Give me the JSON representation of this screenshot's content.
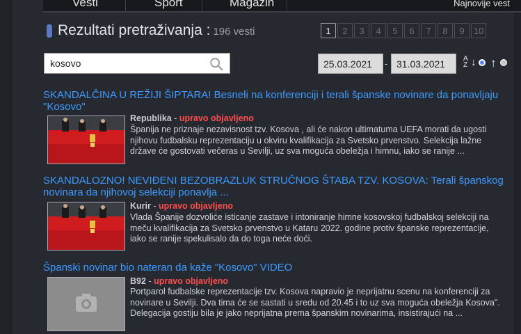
{
  "nav": {
    "items": [
      "Vesti",
      "Sport",
      "Magazin"
    ],
    "right": "Najnovije vest"
  },
  "search_header": {
    "title": "Rezultati pretraživanja :",
    "count": "196 vesti"
  },
  "pagination": [
    "1",
    "2",
    "3",
    "4",
    "5",
    "6",
    "7",
    "8",
    "9",
    "10"
  ],
  "search": {
    "value": "kosovo",
    "icon": "search-icon"
  },
  "dates": {
    "from": "25.03.2021",
    "separator": "-",
    "to": "31.03.2021"
  },
  "sort": {
    "az_top": "A",
    "az_bottom": "Z",
    "az_arrow": "↓",
    "date_arrow": "↑"
  },
  "articles": [
    {
      "title": "SKANDALČINA U REŽIJI ŠIPTARA! Besneli na konferenciji i terali španske novinare da ponavljaju \"Kosovo\"",
      "source": "Republika",
      "dash": "-",
      "badge": "upravo objavljeno",
      "excerpt": "Španija ne priznaje nezavisnost tzv. Kosova , ali će nakon ultimatuma UEFA morati da ugosti njihovu fudbalsku reprezentaciju u okviru kvalifikacija za Svetsko prvenstvo. Selekcija lažne države će gostovati večeras u Sevilji, uz sva moguća obeležja i himnu, iako se ranije ..."
    },
    {
      "title": "SKANDALOZNO! NEVIĐENI BEZOBRAZLUK STRUČNOG ŠTABA TZV. KOSOVA: Terali španskog novinara da njihovoj selekciji ponavlja ...",
      "source": "Kurir",
      "dash": "-",
      "badge": "upravo objavljeno",
      "excerpt": "Vlada Španije dozvoliće isticanje zastave i intoniranje himne kosovskoj fudbalskoj selekciji na meču kvalifikacija za Svetsko prvenstvo u Kataru 2022. godine protiv španske reprezentacije, iako se ranije spekulisalo da do toga neće doći."
    },
    {
      "title": "Španski novinar bio nateran da kaže \"Kosovo\" VIDEO",
      "source": "B92",
      "dash": "-",
      "badge": "upravo objavljeno",
      "excerpt": "Portparol fudbalske reprezentacije tzv. Kosova napravio je neprijatnu scenu na konferenciji za novinare u Sevilji. Dva tima će se sastati u sredu od 20.45 i to uz sva moguća obeležja Kosova\". Delegacija gostiju bila je jako neprijatna prema španskim novinarima, insistirajući na ..."
    }
  ],
  "colors": {
    "background": "#262930",
    "link": "#3d9bff",
    "badge": "#ff4d4d",
    "accent": "#5c7ac4"
  }
}
